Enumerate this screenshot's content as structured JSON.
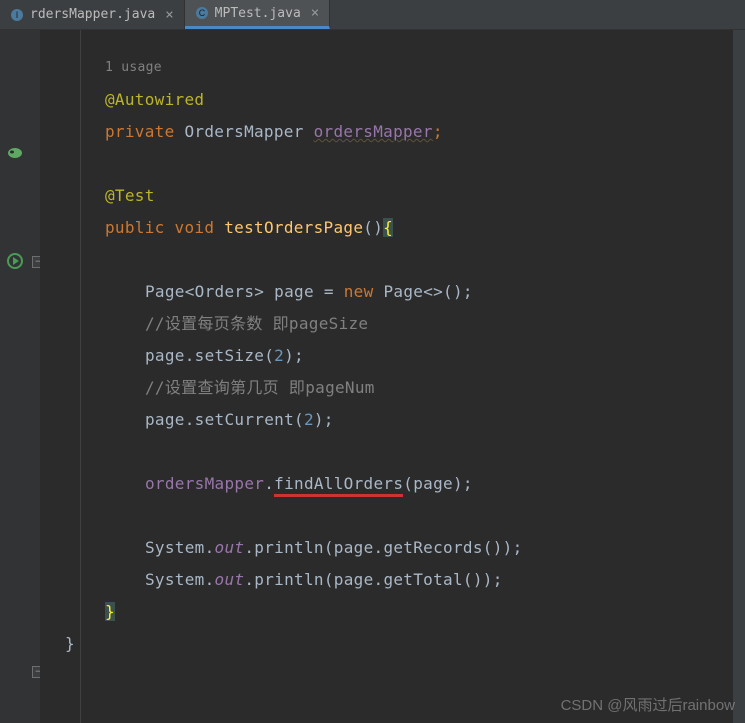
{
  "tabs": [
    {
      "label": "rdersMapper.java",
      "active": false
    },
    {
      "label": "MPTest.java",
      "active": true
    }
  ],
  "code": {
    "usage": "1 usage",
    "autowired": "@Autowired",
    "private": "private",
    "type_orders_mapper": "OrdersMapper",
    "field_orders_mapper": "ordersMapper",
    "test": "@Test",
    "public": "public",
    "void": "void",
    "method_name": "testOrdersPage",
    "page_type": "Page",
    "orders_type": "Orders",
    "page_var": "page",
    "new_kw": "new",
    "comment1": "//设置每页条数 即pageSize",
    "set_size": "setSize",
    "num2": "2",
    "comment2": "//设置查询第几页 即pageNum",
    "set_current": "setCurrent",
    "find_all": "findAllOrders",
    "system": "System",
    "out": "out",
    "println": "println",
    "get_records": "getRecords",
    "get_total": "getTotal"
  },
  "watermark": "CSDN @风雨过后rainbow"
}
